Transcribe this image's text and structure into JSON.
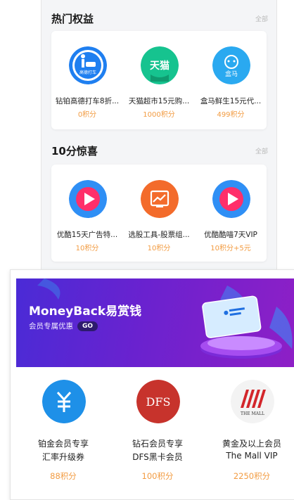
{
  "hot": {
    "title": "热门权益",
    "more": "全部",
    "items": [
      {
        "name": "钻铂高德打车8折...",
        "points": "0积分",
        "icon": "amap-taxi-icon",
        "icon_text": "高德打车"
      },
      {
        "name": "天猫超市15元购...",
        "points": "1000积分",
        "icon": "tmall-icon",
        "icon_text": "天猫"
      },
      {
        "name": "盒马鲜生15元代...",
        "points": "499积分",
        "icon": "hema-icon",
        "icon_text": "盒马"
      }
    ]
  },
  "surprise": {
    "title": "10分惊喜",
    "more": "全部",
    "items": [
      {
        "name": "优酷15天广告特...",
        "points": "10积分",
        "icon": "youku-icon"
      },
      {
        "name": "选股工具-股票组...",
        "points": "10积分",
        "icon": "stock-chart-icon"
      },
      {
        "name": "优酷酷喵7天VIP",
        "points": "10积分+5元",
        "icon": "youku-icon"
      }
    ]
  },
  "moneyback": {
    "title": "MoneyBack易赏钱",
    "subtitle": "会员专属优惠",
    "go": "GO",
    "items": [
      {
        "line1": "铂金会员专享",
        "line2": "汇率升级券",
        "points": "88积分",
        "icon": "yuan-exchange-icon"
      },
      {
        "line1": "钻石会员专享",
        "line2": "DFS黑卡会员",
        "points": "100积分",
        "icon": "dfs-logo-icon",
        "logo": "DFS"
      },
      {
        "line1": "黄金及以上会员",
        "line2": "The Mall VIP",
        "points": "2250积分",
        "icon": "the-mall-logo-icon",
        "logo": "THE MALL"
      }
    ]
  },
  "colors": {
    "accent_points": "#f29b41",
    "banner": "#5a27d3"
  }
}
